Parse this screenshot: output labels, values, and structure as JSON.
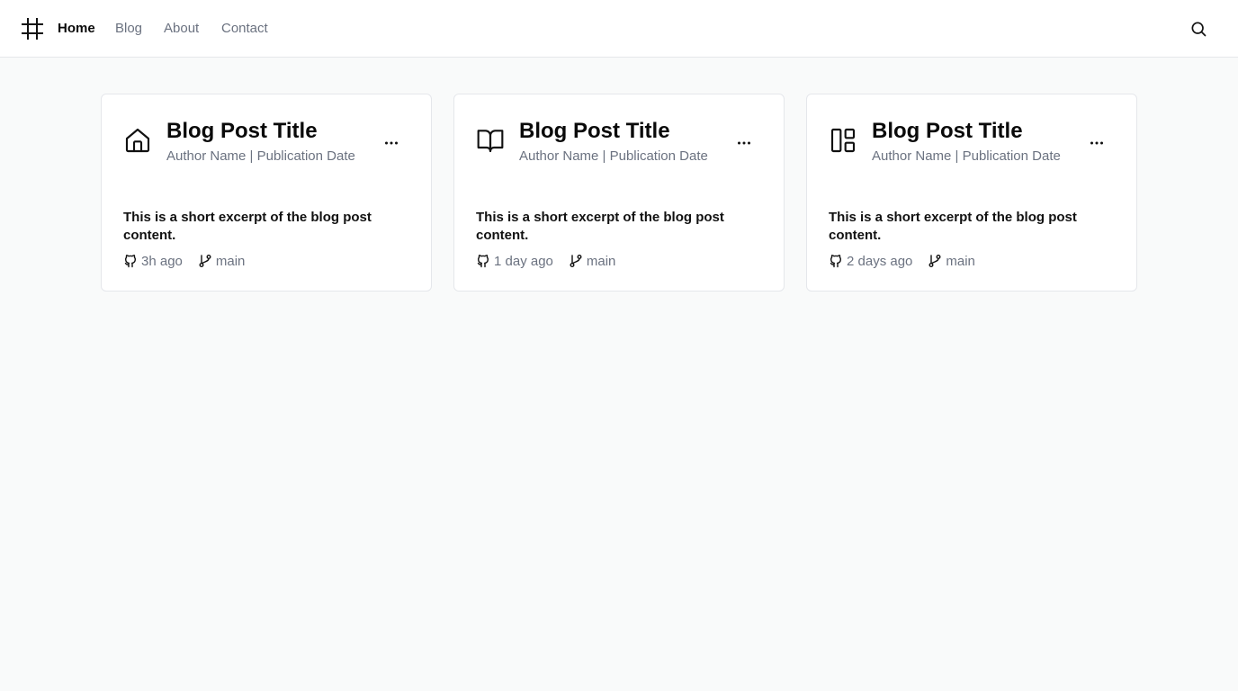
{
  "nav": {
    "links": [
      "Home",
      "Blog",
      "About",
      "Contact"
    ],
    "active": "Home",
    "logo_icon": "frame-icon",
    "search_icon": "search-icon"
  },
  "cards": [
    {
      "icon": "home-icon",
      "title": "Blog Post Title",
      "meta": "Author Name | Publication Date",
      "excerpt": "This is a short excerpt of the blog post content.",
      "time": "3h ago",
      "branch": "main"
    },
    {
      "icon": "book-open-icon",
      "title": "Blog Post Title",
      "meta": "Author Name | Publication Date",
      "excerpt": "This is a short excerpt of the blog post content.",
      "time": "1 day ago",
      "branch": "main"
    },
    {
      "icon": "layout-icon",
      "title": "Blog Post Title",
      "meta": "Author Name | Publication Date",
      "excerpt": "This is a short excerpt of the blog post content.",
      "time": "2 days ago",
      "branch": "main"
    }
  ],
  "colors": {
    "page_background": "#f9fafa",
    "card_background": "#ffffff",
    "border": "#e5e7eb",
    "muted_text": "#6b7280",
    "primary_text": "#0a0a0a"
  }
}
